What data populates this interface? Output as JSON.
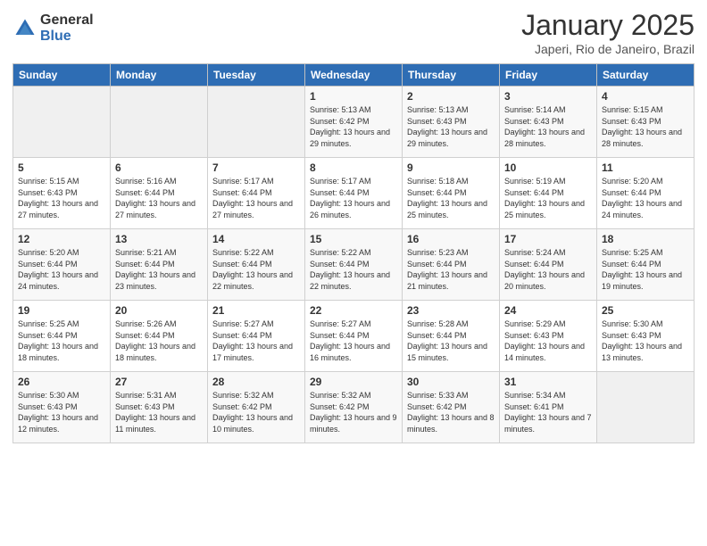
{
  "header": {
    "logo_general": "General",
    "logo_blue": "Blue",
    "month_title": "January 2025",
    "location": "Japeri, Rio de Janeiro, Brazil"
  },
  "weekdays": [
    "Sunday",
    "Monday",
    "Tuesday",
    "Wednesday",
    "Thursday",
    "Friday",
    "Saturday"
  ],
  "weeks": [
    [
      {
        "day": "",
        "sunrise": "",
        "sunset": "",
        "daylight": ""
      },
      {
        "day": "",
        "sunrise": "",
        "sunset": "",
        "daylight": ""
      },
      {
        "day": "",
        "sunrise": "",
        "sunset": "",
        "daylight": ""
      },
      {
        "day": "1",
        "sunrise": "Sunrise: 5:13 AM",
        "sunset": "Sunset: 6:42 PM",
        "daylight": "Daylight: 13 hours and 29 minutes."
      },
      {
        "day": "2",
        "sunrise": "Sunrise: 5:13 AM",
        "sunset": "Sunset: 6:43 PM",
        "daylight": "Daylight: 13 hours and 29 minutes."
      },
      {
        "day": "3",
        "sunrise": "Sunrise: 5:14 AM",
        "sunset": "Sunset: 6:43 PM",
        "daylight": "Daylight: 13 hours and 28 minutes."
      },
      {
        "day": "4",
        "sunrise": "Sunrise: 5:15 AM",
        "sunset": "Sunset: 6:43 PM",
        "daylight": "Daylight: 13 hours and 28 minutes."
      }
    ],
    [
      {
        "day": "5",
        "sunrise": "Sunrise: 5:15 AM",
        "sunset": "Sunset: 6:43 PM",
        "daylight": "Daylight: 13 hours and 27 minutes."
      },
      {
        "day": "6",
        "sunrise": "Sunrise: 5:16 AM",
        "sunset": "Sunset: 6:44 PM",
        "daylight": "Daylight: 13 hours and 27 minutes."
      },
      {
        "day": "7",
        "sunrise": "Sunrise: 5:17 AM",
        "sunset": "Sunset: 6:44 PM",
        "daylight": "Daylight: 13 hours and 27 minutes."
      },
      {
        "day": "8",
        "sunrise": "Sunrise: 5:17 AM",
        "sunset": "Sunset: 6:44 PM",
        "daylight": "Daylight: 13 hours and 26 minutes."
      },
      {
        "day": "9",
        "sunrise": "Sunrise: 5:18 AM",
        "sunset": "Sunset: 6:44 PM",
        "daylight": "Daylight: 13 hours and 25 minutes."
      },
      {
        "day": "10",
        "sunrise": "Sunrise: 5:19 AM",
        "sunset": "Sunset: 6:44 PM",
        "daylight": "Daylight: 13 hours and 25 minutes."
      },
      {
        "day": "11",
        "sunrise": "Sunrise: 5:20 AM",
        "sunset": "Sunset: 6:44 PM",
        "daylight": "Daylight: 13 hours and 24 minutes."
      }
    ],
    [
      {
        "day": "12",
        "sunrise": "Sunrise: 5:20 AM",
        "sunset": "Sunset: 6:44 PM",
        "daylight": "Daylight: 13 hours and 24 minutes."
      },
      {
        "day": "13",
        "sunrise": "Sunrise: 5:21 AM",
        "sunset": "Sunset: 6:44 PM",
        "daylight": "Daylight: 13 hours and 23 minutes."
      },
      {
        "day": "14",
        "sunrise": "Sunrise: 5:22 AM",
        "sunset": "Sunset: 6:44 PM",
        "daylight": "Daylight: 13 hours and 22 minutes."
      },
      {
        "day": "15",
        "sunrise": "Sunrise: 5:22 AM",
        "sunset": "Sunset: 6:44 PM",
        "daylight": "Daylight: 13 hours and 22 minutes."
      },
      {
        "day": "16",
        "sunrise": "Sunrise: 5:23 AM",
        "sunset": "Sunset: 6:44 PM",
        "daylight": "Daylight: 13 hours and 21 minutes."
      },
      {
        "day": "17",
        "sunrise": "Sunrise: 5:24 AM",
        "sunset": "Sunset: 6:44 PM",
        "daylight": "Daylight: 13 hours and 20 minutes."
      },
      {
        "day": "18",
        "sunrise": "Sunrise: 5:25 AM",
        "sunset": "Sunset: 6:44 PM",
        "daylight": "Daylight: 13 hours and 19 minutes."
      }
    ],
    [
      {
        "day": "19",
        "sunrise": "Sunrise: 5:25 AM",
        "sunset": "Sunset: 6:44 PM",
        "daylight": "Daylight: 13 hours and 18 minutes."
      },
      {
        "day": "20",
        "sunrise": "Sunrise: 5:26 AM",
        "sunset": "Sunset: 6:44 PM",
        "daylight": "Daylight: 13 hours and 18 minutes."
      },
      {
        "day": "21",
        "sunrise": "Sunrise: 5:27 AM",
        "sunset": "Sunset: 6:44 PM",
        "daylight": "Daylight: 13 hours and 17 minutes."
      },
      {
        "day": "22",
        "sunrise": "Sunrise: 5:27 AM",
        "sunset": "Sunset: 6:44 PM",
        "daylight": "Daylight: 13 hours and 16 minutes."
      },
      {
        "day": "23",
        "sunrise": "Sunrise: 5:28 AM",
        "sunset": "Sunset: 6:44 PM",
        "daylight": "Daylight: 13 hours and 15 minutes."
      },
      {
        "day": "24",
        "sunrise": "Sunrise: 5:29 AM",
        "sunset": "Sunset: 6:43 PM",
        "daylight": "Daylight: 13 hours and 14 minutes."
      },
      {
        "day": "25",
        "sunrise": "Sunrise: 5:30 AM",
        "sunset": "Sunset: 6:43 PM",
        "daylight": "Daylight: 13 hours and 13 minutes."
      }
    ],
    [
      {
        "day": "26",
        "sunrise": "Sunrise: 5:30 AM",
        "sunset": "Sunset: 6:43 PM",
        "daylight": "Daylight: 13 hours and 12 minutes."
      },
      {
        "day": "27",
        "sunrise": "Sunrise: 5:31 AM",
        "sunset": "Sunset: 6:43 PM",
        "daylight": "Daylight: 13 hours and 11 minutes."
      },
      {
        "day": "28",
        "sunrise": "Sunrise: 5:32 AM",
        "sunset": "Sunset: 6:42 PM",
        "daylight": "Daylight: 13 hours and 10 minutes."
      },
      {
        "day": "29",
        "sunrise": "Sunrise: 5:32 AM",
        "sunset": "Sunset: 6:42 PM",
        "daylight": "Daylight: 13 hours and 9 minutes."
      },
      {
        "day": "30",
        "sunrise": "Sunrise: 5:33 AM",
        "sunset": "Sunset: 6:42 PM",
        "daylight": "Daylight: 13 hours and 8 minutes."
      },
      {
        "day": "31",
        "sunrise": "Sunrise: 5:34 AM",
        "sunset": "Sunset: 6:41 PM",
        "daylight": "Daylight: 13 hours and 7 minutes."
      },
      {
        "day": "",
        "sunrise": "",
        "sunset": "",
        "daylight": ""
      }
    ]
  ]
}
